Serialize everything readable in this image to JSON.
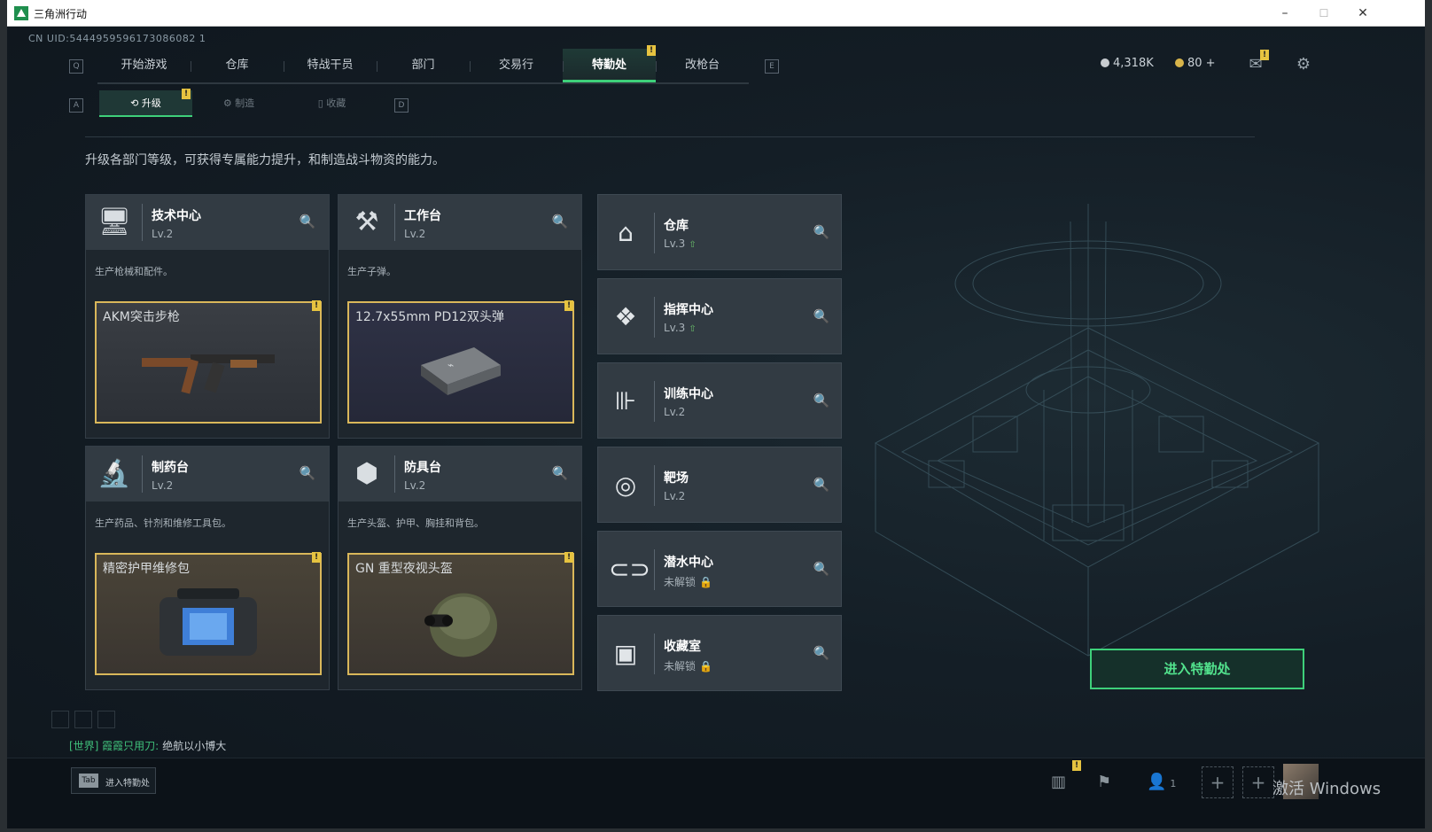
{
  "window": {
    "title": "三角洲行动",
    "minimize": "–",
    "maximize": "☐",
    "close": "✕"
  },
  "uid": "CN UID:5444959596173086082 1",
  "nav": {
    "left_hint": "Q",
    "right_hint": "E",
    "tabs": [
      {
        "label": "开始游戏"
      },
      {
        "label": "仓库"
      },
      {
        "label": "特战干员"
      },
      {
        "label": "部门"
      },
      {
        "label": "交易行"
      },
      {
        "label": "特勤处",
        "active": true
      },
      {
        "label": "改枪台"
      }
    ],
    "badge": "!"
  },
  "currency": {
    "silver": "4,318K",
    "gold": "80 +"
  },
  "subnav": {
    "left_hint": "A",
    "right_hint": "D",
    "tabs": [
      {
        "label": "升级",
        "active": true
      },
      {
        "label": "制造"
      },
      {
        "label": "收藏"
      }
    ]
  },
  "description": "升级各部门等级，可获得专属能力提升，和制造战斗物资的能力。",
  "cards": [
    {
      "name": "技术中心",
      "level": "Lv.2",
      "desc": "生产枪械和配件。",
      "product": "AKM突击步枪",
      "badge": "!",
      "icon": "monitor-icon"
    },
    {
      "name": "工作台",
      "level": "Lv.2",
      "desc": "生产子弹。",
      "product": "12.7x55mm PD12双头弹",
      "badge": "!",
      "icon": "tools-icon"
    },
    {
      "name": "制药台",
      "level": "Lv.2",
      "desc": "生产药品、针剂和维修工具包。",
      "product": "精密护甲维修包",
      "badge": "!",
      "icon": "microscope-icon"
    },
    {
      "name": "防具台",
      "level": "Lv.2",
      "desc": "生产头盔、护甲、胸挂和背包。",
      "product": "GN 重型夜视头盔",
      "badge": "!",
      "icon": "armor-icon"
    }
  ],
  "facilities": [
    {
      "name": "仓库",
      "level": "Lv.3",
      "upgradable": true,
      "icon": "warehouse-icon"
    },
    {
      "name": "指挥中心",
      "level": "Lv.3",
      "upgradable": true,
      "icon": "command-icon"
    },
    {
      "name": "训练中心",
      "level": "Lv.2",
      "upgradable": false,
      "icon": "dumbbell-icon"
    },
    {
      "name": "靶场",
      "level": "Lv.2",
      "upgradable": false,
      "icon": "target-icon"
    },
    {
      "name": "潜水中心",
      "level": "未解锁",
      "locked": true,
      "icon": "diving-mask-icon"
    },
    {
      "name": "收藏室",
      "level": "未解锁",
      "locked": true,
      "icon": "vault-icon"
    }
  ],
  "enter_button": "进入特勤处",
  "chat": {
    "channel": "[世界] 霞霞只用刀:",
    "message": "绝航以小博大"
  },
  "bottom": {
    "tab_key": "Tab",
    "tab_label": "进入特勤处",
    "friends_count": "1",
    "badge": "!",
    "watermark": "激活 Windows"
  },
  "colors": {
    "accent": "#3ed07a",
    "badge": "#e6c340",
    "product_border": "#d9b75a"
  }
}
